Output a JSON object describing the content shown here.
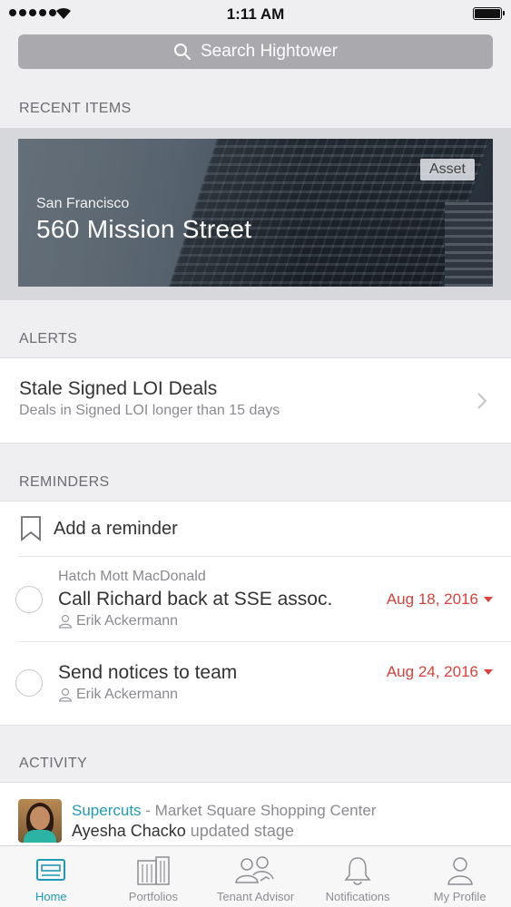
{
  "status_bar": {
    "time": "1:11 AM"
  },
  "search": {
    "placeholder": "Search Hightower"
  },
  "recent_items": {
    "section_title": "RECENT ITEMS",
    "card": {
      "badge": "Asset",
      "city": "San Francisco",
      "title": "560 Mission Street"
    }
  },
  "alerts": {
    "section_title": "ALERTS",
    "items": [
      {
        "title": "Stale Signed LOI Deals",
        "subtitle": "Deals in Signed LOI longer than 15 days"
      }
    ]
  },
  "reminders": {
    "section_title": "REMINDERS",
    "add_label": "Add a reminder",
    "items": [
      {
        "company": "Hatch Mott MacDonald",
        "title": "Call Richard back at SSE assoc.",
        "person": "Erik Ackermann",
        "date": "Aug 18, 2016"
      },
      {
        "company": "",
        "title": "Send notices to team",
        "person": "Erik Ackermann",
        "date": "Aug 24, 2016"
      }
    ]
  },
  "activity": {
    "section_title": "ACTIVITY",
    "items": [
      {
        "brand": "Supercuts",
        "location": " - Market Square Shopping Center",
        "person": "Ayesha Chacko",
        "action": " updated stage"
      }
    ]
  },
  "tab_bar": {
    "active": "Home",
    "tabs": [
      {
        "label": "Home",
        "icon": "home-icon"
      },
      {
        "label": "Portfolios",
        "icon": "building-icon"
      },
      {
        "label": "Tenant Advisor",
        "icon": "people-icon"
      },
      {
        "label": "Notifications",
        "icon": "bell-icon"
      },
      {
        "label": "My Profile",
        "icon": "user-icon"
      }
    ]
  },
  "colors": {
    "accent": "#1f9ab5",
    "alert_date": "#d9403a",
    "search_bg": "#a9a9ae"
  }
}
